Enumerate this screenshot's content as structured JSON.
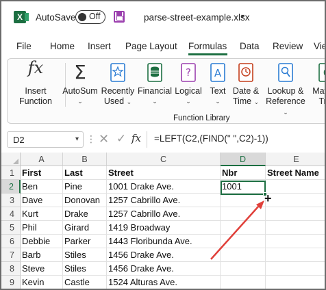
{
  "titlebar": {
    "autosave_label": "AutoSave",
    "toggle_state": "Off",
    "filename": "parse-street-example.xlsx",
    "caret": "▾"
  },
  "tabs": [
    "File",
    "Home",
    "Insert",
    "Page Layout",
    "Formulas",
    "Data",
    "Review",
    "View"
  ],
  "active_tab": "Formulas",
  "ribbon": {
    "insert_function": [
      "Insert",
      "Function"
    ],
    "autosum": "AutoSum",
    "recently_used": [
      "Recently",
      "Used"
    ],
    "financial": "Financial",
    "logical": "Logical",
    "text": "Text",
    "date_time": [
      "Date &",
      "Time"
    ],
    "lookup_reference": [
      "Lookup &",
      "Reference"
    ],
    "math_trig": [
      "Math &",
      "Trig"
    ],
    "group_label": "Function Library",
    "chevron": "⌄"
  },
  "formula_bar": {
    "name_box": "D2",
    "formula": "=LEFT(C2,(FIND(\" \",C2)-1))"
  },
  "grid": {
    "columns": [
      "A",
      "B",
      "C",
      "D",
      "E"
    ],
    "selected_column": "D",
    "selected_row": "2",
    "rows": [
      {
        "n": "1",
        "cells": [
          "First",
          "Last",
          "Street",
          "Nbr",
          "Street Name"
        ]
      },
      {
        "n": "2",
        "cells": [
          "Ben",
          "Pine",
          "1001 Drake Ave.",
          "1001",
          ""
        ]
      },
      {
        "n": "3",
        "cells": [
          "Dave",
          "Donovan",
          "1257 Cabrillo Ave.",
          "",
          ""
        ]
      },
      {
        "n": "4",
        "cells": [
          "Kurt",
          "Drake",
          "1257 Cabrillo Ave.",
          "",
          ""
        ]
      },
      {
        "n": "5",
        "cells": [
          "Phil",
          "Girard",
          "1419 Broadway",
          "",
          ""
        ]
      },
      {
        "n": "6",
        "cells": [
          "Debbie",
          "Parker",
          "1443 Floribunda Ave.",
          "",
          ""
        ]
      },
      {
        "n": "7",
        "cells": [
          "Barb",
          "Stiles",
          "1456 Drake Ave.",
          "",
          ""
        ]
      },
      {
        "n": "8",
        "cells": [
          "Steve",
          "Stiles",
          "1456 Drake Ave.",
          "",
          ""
        ]
      },
      {
        "n": "9",
        "cells": [
          "Kevin",
          "Castle",
          "1524 Alturas Ave.",
          "",
          ""
        ]
      }
    ]
  },
  "colors": {
    "excel_green": "#1d6f42",
    "annotation_arrow": "#e0403a"
  }
}
